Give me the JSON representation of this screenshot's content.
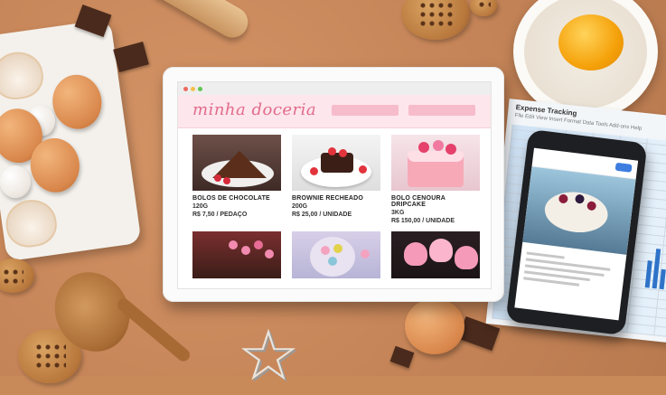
{
  "site": {
    "logo_text": "minha doceria"
  },
  "products": [
    {
      "name": "BOLOS DE CHOCOLATE",
      "weight": "120G",
      "price": "R$ 7,50 / PEDAÇO"
    },
    {
      "name": "BROWNIE RECHEADO",
      "weight": "200G",
      "price": "R$ 25,00 / UNIDADE"
    },
    {
      "name": "BOLO CENOURA DRIPCAKE",
      "weight": "3KG",
      "price": "R$ 150,00 / UNIDADE"
    }
  ],
  "spreadsheet": {
    "title": "Expense Tracking",
    "menu": "File  Edit  View  Insert  Format  Data  Tools  Add-ons  Help"
  },
  "colors": {
    "header_bg": "#fde6ec",
    "logo": "#e26b8b",
    "nav_button": "#f7bccb"
  }
}
